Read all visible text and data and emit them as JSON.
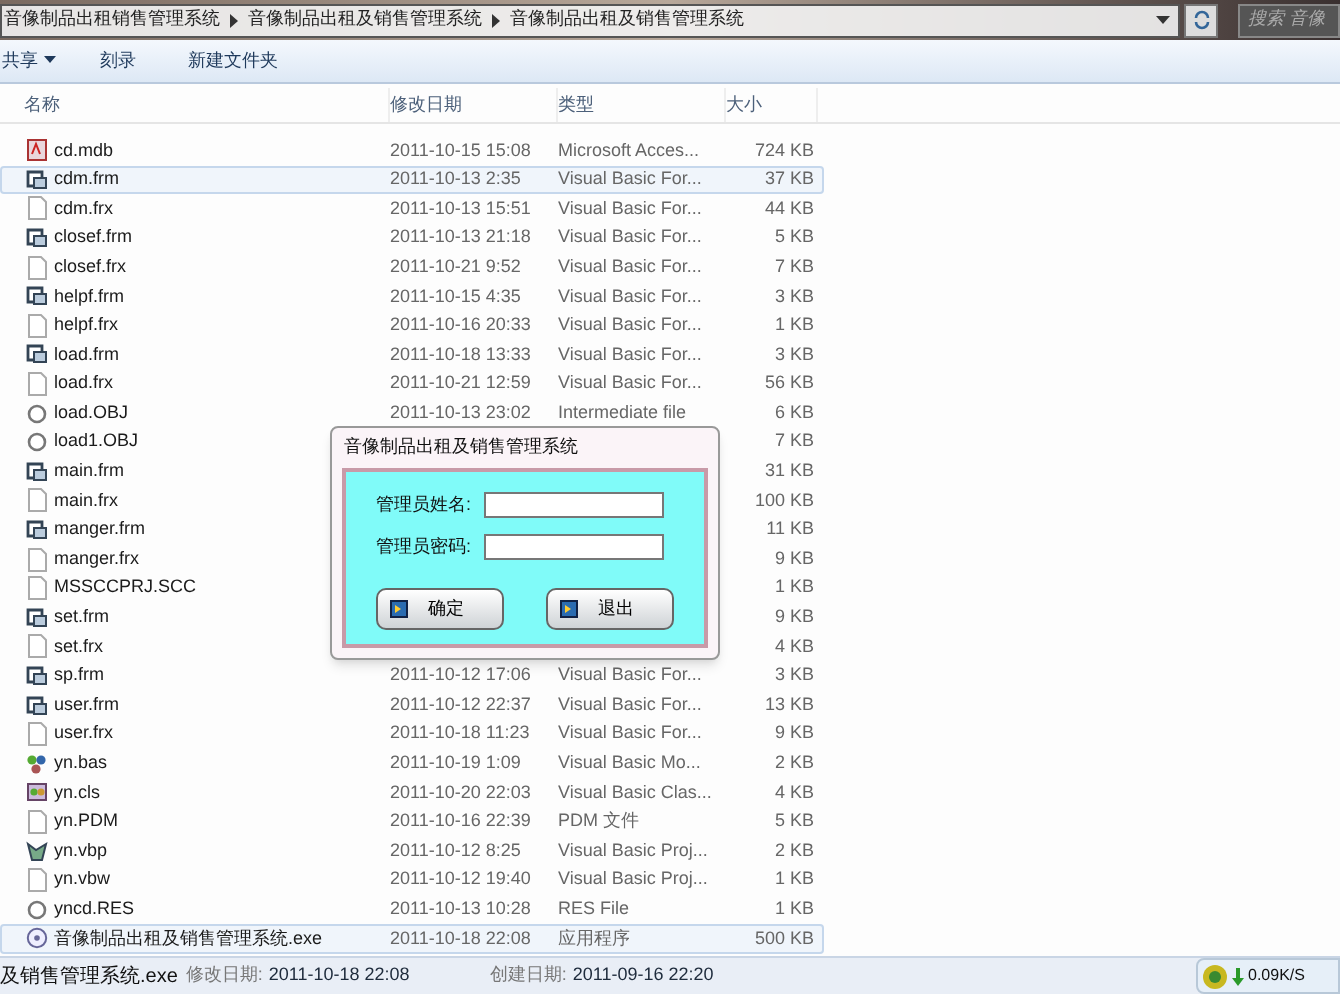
{
  "address_bar": {
    "crumbs": [
      "音像制品出租销售管理系统",
      "音像制品出租及销售管理系统",
      "音像制品出租及销售管理系统"
    ],
    "search": {
      "placeholder": "搜索 音像"
    }
  },
  "toolbar": [
    "共享",
    "刻录",
    "新建文件夹"
  ],
  "table": {
    "columns": [
      "名称",
      "修改日期",
      "类型",
      "大小"
    ],
    "rows": [
      {
        "kind": "db",
        "name": "cd.mdb",
        "date": "2011-10-15 15:08",
        "type": "Microsoft Acces...",
        "size": "724 KB",
        "selected": false
      },
      {
        "kind": "form",
        "name": "cdm.frm",
        "date": "2011-10-13 2:35",
        "type": "Visual Basic For...",
        "size": "37 KB",
        "selected": true
      },
      {
        "kind": "file",
        "name": "cdm.frx",
        "date": "2011-10-13 15:51",
        "type": "Visual Basic For...",
        "size": "44 KB",
        "selected": false
      },
      {
        "kind": "form",
        "name": "closef.frm",
        "date": "2011-10-13 21:18",
        "type": "Visual Basic For...",
        "size": "5 KB",
        "selected": false
      },
      {
        "kind": "file",
        "name": "closef.frx",
        "date": "2011-10-21 9:52",
        "type": "Visual Basic For...",
        "size": "7 KB",
        "selected": false
      },
      {
        "kind": "form",
        "name": "helpf.frm",
        "date": "2011-10-15 4:35",
        "type": "Visual Basic For...",
        "size": "3 KB",
        "selected": false
      },
      {
        "kind": "file",
        "name": "helpf.frx",
        "date": "2011-10-16 20:33",
        "type": "Visual Basic For...",
        "size": "1 KB",
        "selected": false
      },
      {
        "kind": "form",
        "name": "load.frm",
        "date": "2011-10-18 13:33",
        "type": "Visual Basic For...",
        "size": "3 KB",
        "selected": false
      },
      {
        "kind": "file",
        "name": "load.frx",
        "date": "2011-10-21 12:59",
        "type": "Visual Basic For...",
        "size": "56 KB",
        "selected": false
      },
      {
        "kind": "obj",
        "name": "load.OBJ",
        "date": "2011-10-13 23:02",
        "type": "Intermediate file",
        "size": "6 KB",
        "selected": false
      },
      {
        "kind": "obj",
        "name": "load1.OBJ",
        "size": "7 KB",
        "selected": false
      },
      {
        "kind": "form",
        "name": "main.frm",
        "size": "31 KB",
        "selected": false
      },
      {
        "kind": "file",
        "name": "main.frx",
        "size": "100 KB",
        "selected": false
      },
      {
        "kind": "form",
        "name": "manger.frm",
        "size": "11 KB",
        "selected": false
      },
      {
        "kind": "file",
        "name": "manger.frx",
        "size": "9 KB",
        "selected": false
      },
      {
        "kind": "file",
        "name": "MSSCCPRJ.SCC",
        "size": "1 KB",
        "selected": false
      },
      {
        "kind": "form",
        "name": "set.frm",
        "size": "9 KB",
        "selected": false
      },
      {
        "kind": "file",
        "name": "set.frx",
        "size": "4 KB",
        "selected": false
      },
      {
        "kind": "form",
        "name": "sp.frm",
        "date": "2011-10-12 17:06",
        "type": "Visual Basic For...",
        "size": "3 KB",
        "selected": false
      },
      {
        "kind": "form",
        "name": "user.frm",
        "date": "2011-10-12 22:37",
        "type": "Visual Basic For...",
        "size": "13 KB",
        "selected": false
      },
      {
        "kind": "file",
        "name": "user.frx",
        "date": "2011-10-18 11:23",
        "type": "Visual Basic For...",
        "size": "9 KB",
        "selected": false
      },
      {
        "kind": "module",
        "name": "yn.bas",
        "date": "2011-10-19 1:09",
        "type": "Visual Basic Mo...",
        "size": "2 KB",
        "selected": false
      },
      {
        "kind": "class",
        "name": "yn.cls",
        "date": "2011-10-20 22:03",
        "type": "Visual Basic Clas...",
        "size": "4 KB",
        "selected": false
      },
      {
        "kind": "file",
        "name": "yn.PDM",
        "date": "2011-10-16 22:39",
        "type": "PDM 文件",
        "size": "5 KB",
        "selected": false
      },
      {
        "kind": "project",
        "name": "yn.vbp",
        "date": "2011-10-12 8:25",
        "type": "Visual Basic Proj...",
        "size": "2 KB",
        "selected": false
      },
      {
        "kind": "file",
        "name": "yn.vbw",
        "date": "2011-10-12 19:40",
        "type": "Visual Basic Proj...",
        "size": "1 KB",
        "selected": false
      },
      {
        "kind": "obj",
        "name": "yncd.RES",
        "date": "2011-10-13 10:28",
        "type": "RES File",
        "size": "1 KB",
        "selected": false
      },
      {
        "kind": "exe",
        "name": "音像制品出租及销售管理系统.exe",
        "date": "2011-10-18 22:08",
        "type": "应用程序",
        "size": "500 KB",
        "selected": true
      }
    ]
  },
  "dialog": {
    "title": "音像制品出租及销售管理系统",
    "fields": [
      {
        "label": "管理员姓名:"
      },
      {
        "label": "管理员密码:"
      }
    ],
    "buttons": [
      "确定",
      "退出"
    ]
  },
  "status_bar": {
    "name": "及销售管理系统.exe",
    "modified_label": "修改日期:",
    "modified": "2011-10-18 22:08",
    "created_label": "创建日期:",
    "created": "2011-09-16 22:20"
  },
  "tray": {
    "speed": "0.09K/S"
  }
}
